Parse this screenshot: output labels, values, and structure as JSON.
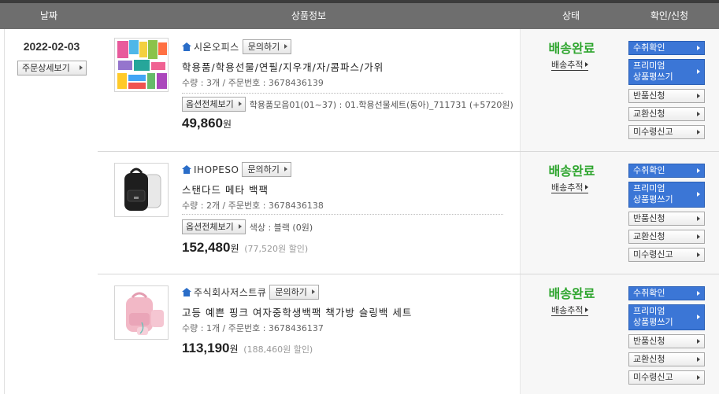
{
  "header": {
    "date": "날짜",
    "info": "상품정보",
    "status": "상태",
    "confirm": "확인/신청"
  },
  "order": {
    "date": "2022-02-03",
    "detail_button": "주문상세보기"
  },
  "items": [
    {
      "seller": "시온오피스",
      "inquiry_label": "문의하기",
      "name": "학용품/학용선물/연필/지우개/자/콤파스/가위",
      "qty_line": "수량 : 3개 / 주문번호 : 3678436139",
      "option_button": "옵션전체보기",
      "option_text": "학용품모음01(01~37) : 01.학용선물세트(동아)_711731 (+5720원)",
      "price": "49,860",
      "currency": "원",
      "discount": "",
      "status": "배송완료",
      "track_label": "배송추적"
    },
    {
      "seller": "IHOPESO",
      "inquiry_label": "문의하기",
      "name": "스탠다드 메타 백팩",
      "qty_line": "수량 : 2개 / 주문번호 : 3678436138",
      "option_button": "옵션전체보기",
      "option_text": "색상 : 블랙 (0원)",
      "price": "152,480",
      "currency": "원",
      "discount": "(77,520원 할인)",
      "status": "배송완료",
      "track_label": "배송추적"
    },
    {
      "seller": "주식회사저스트큐",
      "inquiry_label": "문의하기",
      "name": "고등 예쁜 핑크 여자중학생백팩 책가방 슬링백 세트",
      "qty_line": "수량 : 1개 / 주문번호 : 3678436137",
      "option_button": "",
      "option_text": "",
      "price": "113,190",
      "currency": "원",
      "discount": "(188,460원 할인)",
      "status": "배송완료",
      "track_label": "배송추적"
    }
  ],
  "actions": {
    "receive_confirm": "수취확인",
    "premium_review_1": "프리미엄",
    "premium_review_2": "상품평쓰기",
    "return": "반품신청",
    "exchange": "교환신청",
    "not_received": "미수령신고"
  },
  "colors": {
    "status_green": "#2ea52e",
    "action_blue": "#3b76d6",
    "header_gray": "#6e6e6e"
  }
}
